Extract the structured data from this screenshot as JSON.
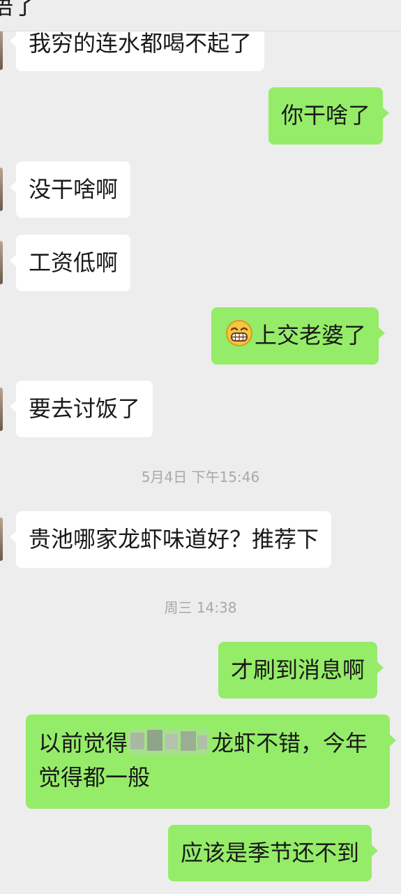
{
  "header": {
    "title": "语了"
  },
  "messages": [
    {
      "side": "in",
      "text": "我穷的连水都喝不起了"
    },
    {
      "side": "out",
      "text": "你干啥了"
    },
    {
      "side": "in",
      "text": "没干啥啊"
    },
    {
      "side": "in",
      "text": "工资低啊"
    },
    {
      "side": "out",
      "text": "上交老婆了",
      "emoji": "grinning-face-emoji"
    },
    {
      "side": "in",
      "text": "要去讨饭了"
    },
    {
      "side": "time",
      "text": "5月4日 下午15:46"
    },
    {
      "side": "in",
      "text": "贵池哪家龙虾味道好？推荐下"
    },
    {
      "side": "time",
      "text": "周三 14:38"
    },
    {
      "side": "out",
      "text": "才刷到消息啊"
    },
    {
      "side": "out",
      "text_before": "以前觉得",
      "redacted": true,
      "text_after": "龙虾不错，今年觉得都一般"
    },
    {
      "side": "out",
      "text": "应该是季节还不到"
    }
  ],
  "colors": {
    "background": "#ededed",
    "incoming_bubble": "#ffffff",
    "outgoing_bubble": "#95ec69",
    "timestamp_text": "#a8a8a8"
  }
}
